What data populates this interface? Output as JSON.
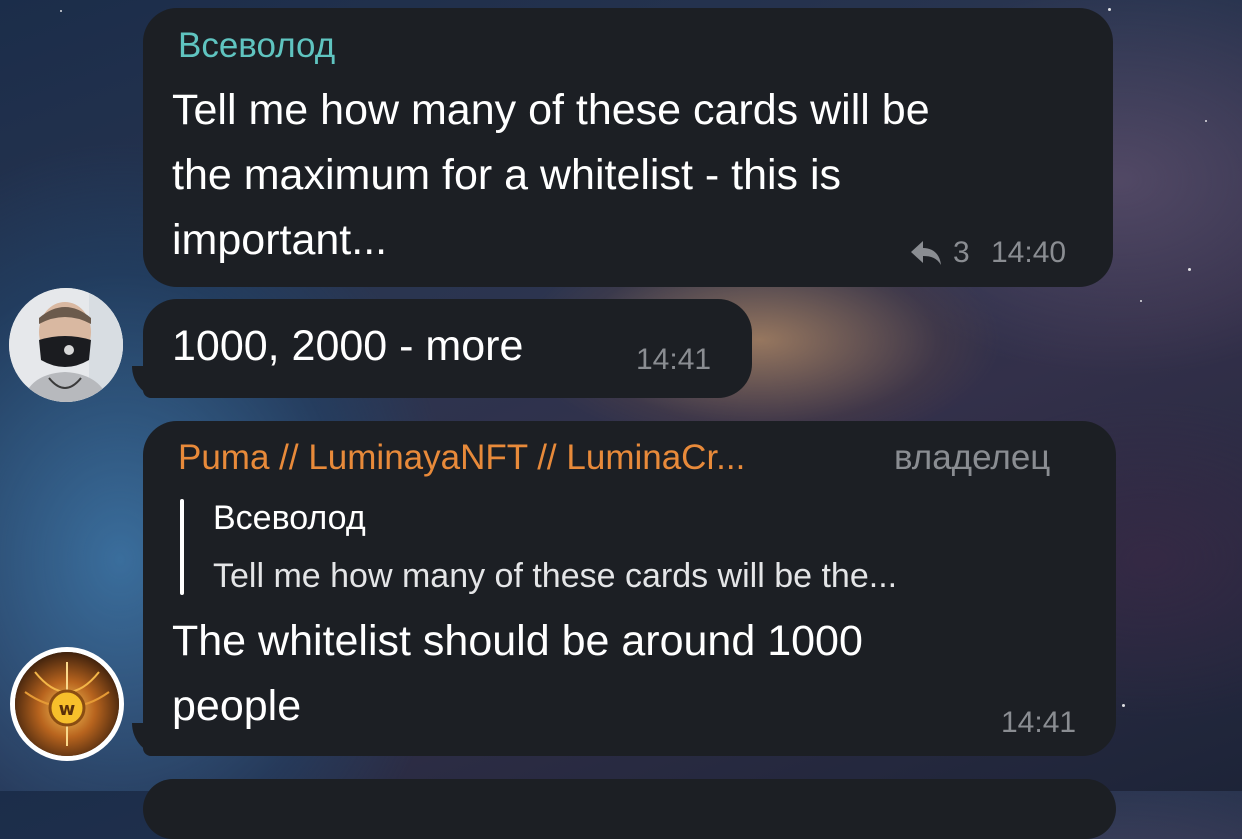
{
  "messages": [
    {
      "sender": "Всеволод",
      "sender_color": "#5fc4c0",
      "text_lines": [
        "Tell me how many of these cards will be",
        "the maximum for a whitelist - this is",
        "important..."
      ],
      "reply_count": "3",
      "time": "14:40"
    },
    {
      "text": "1000, 2000 - more",
      "time": "14:41"
    },
    {
      "sender": "Puma // LuminayaNFT // LuminaCr...",
      "sender_color": "#e88a3a",
      "role": "владелец",
      "quote": {
        "author": "Всеволод",
        "text": "Tell me how many of these cards will be the..."
      },
      "text_lines": [
        "The whitelist should be around 1000",
        "people"
      ],
      "time": "14:41"
    }
  ],
  "icons": {
    "reply": "reply-arrow-icon",
    "avatar_user": "user-avatar-masked",
    "avatar_owner": "gold-w-logo-avatar"
  }
}
